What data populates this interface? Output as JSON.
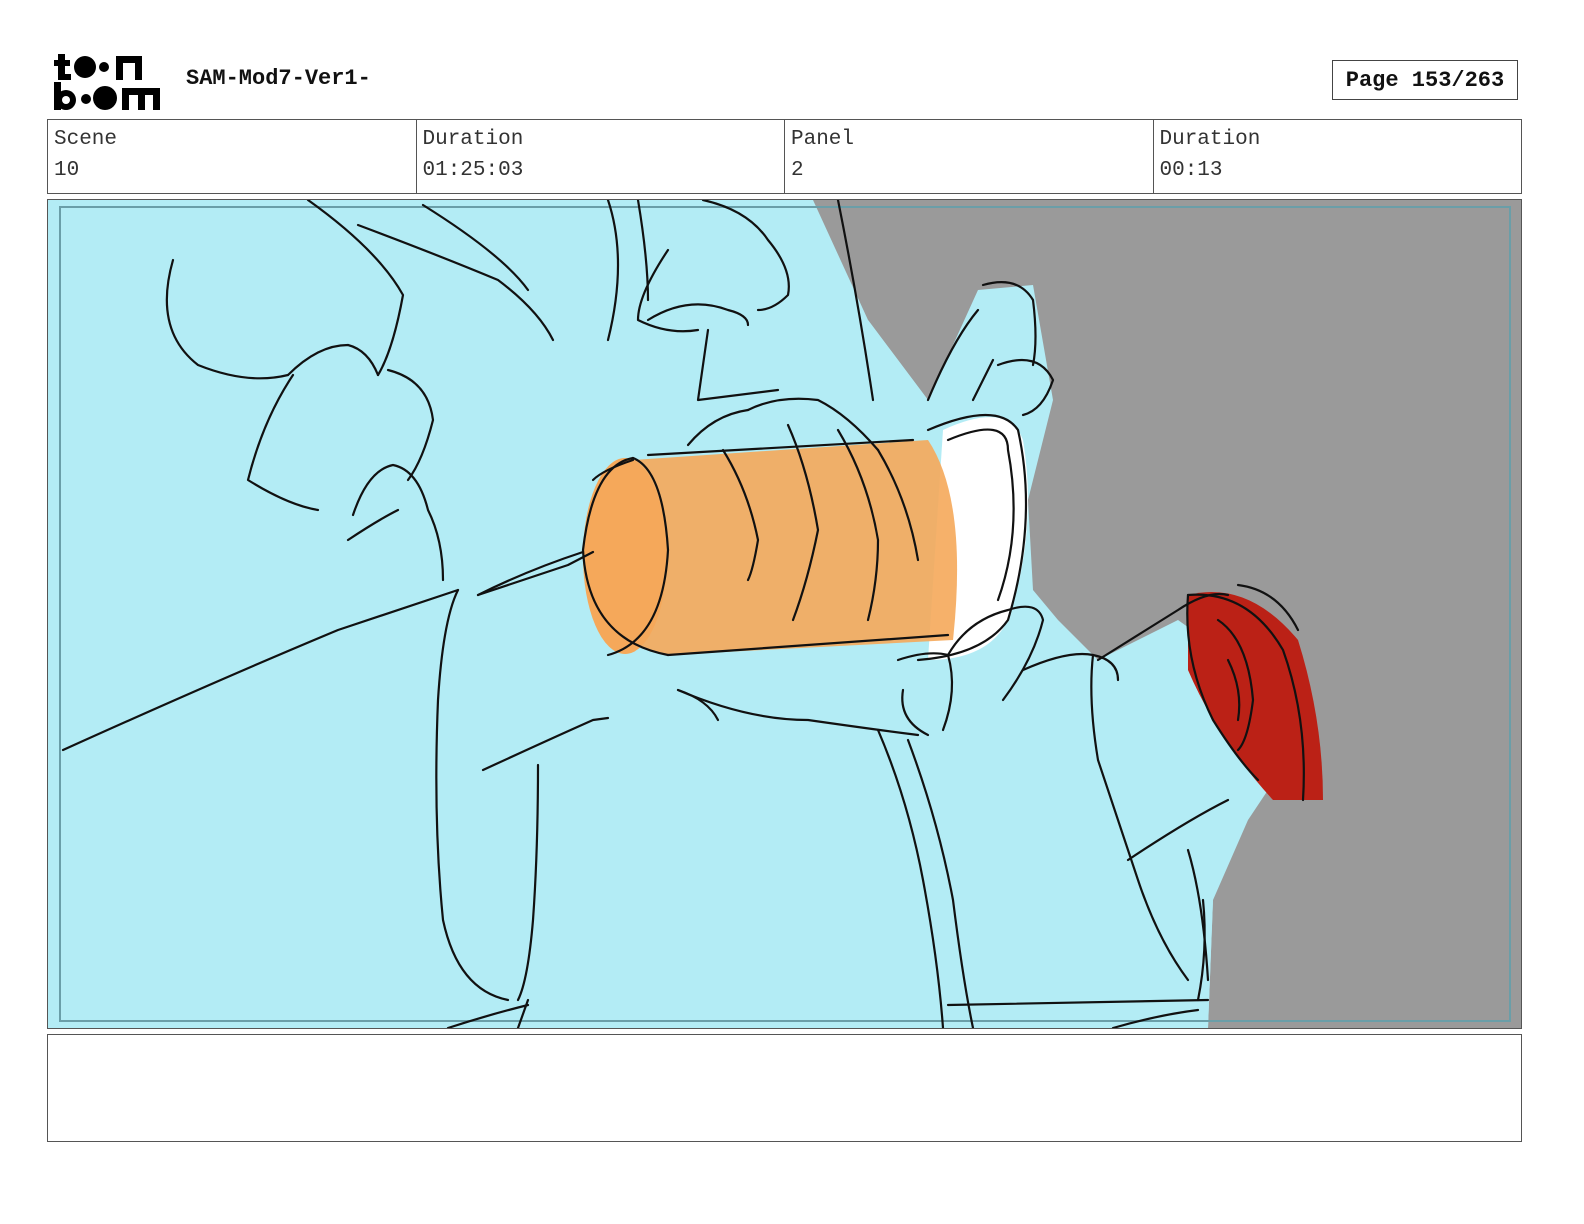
{
  "header": {
    "logo_text": "toon boom",
    "title": "SAM-Mod7-Ver1-",
    "page_indicator": "Page 153/263"
  },
  "info": {
    "scene_label": "Scene",
    "scene_value": "10",
    "scene_duration_label": "Duration",
    "scene_duration_value": "01:25:03",
    "panel_label": "Panel",
    "panel_value": "2",
    "panel_duration_label": "Duration",
    "panel_duration_value": "00:13"
  },
  "panel": {
    "colors": {
      "background_blue": "#b3ecf5",
      "wall_gray": "#9a9a9a",
      "cup_orange": "#f5a85a",
      "gun_red": "#bb2116",
      "ink": "#111111"
    }
  },
  "caption": {
    "text": ""
  }
}
